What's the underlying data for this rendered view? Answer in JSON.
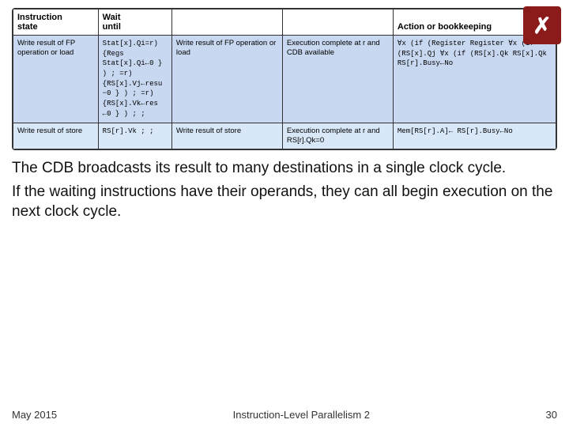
{
  "logo": {
    "symbol": "✗"
  },
  "table": {
    "headers": [
      {
        "id": "instruction",
        "line1": "Instruction",
        "line2": "state"
      },
      {
        "id": "wait",
        "line1": "Wait",
        "line2": "until"
      },
      {
        "id": "write",
        "line1": "",
        "line2": ""
      },
      {
        "id": "execution",
        "line1": "",
        "line2": ""
      },
      {
        "id": "action",
        "line1": "Action or bookkeeping",
        "line2": ""
      }
    ],
    "rows": [
      {
        "instruction": "Write result of FP operation or load",
        "wait": "Stat[x].Qi=r) {Regs Stat[x].Qi←0 } ) ; =r) {RS[x].Vj←resu −0 } ) ; =r) {RS[x].Vk←res ←0 } ) ; ;",
        "write": "Write result of FP operation or load",
        "execution": "Execution complete at r and CDB available",
        "action": "∀x (if (Register Register ∀x (if (RS[x].Qj ∀x (if (RS[x].Qk RS[x].Qk RS[r].Busy←No"
      },
      {
        "instruction": "Write result of store",
        "wait": "RS[r].Vk ; ;",
        "write": "Write result of store",
        "execution": "Execution complete at r and RS[r].Qk=0",
        "action": "Mem[RS[r].A]← RS[r].Busy←No"
      }
    ]
  },
  "text_blocks": [
    "The CDB broadcasts its result to many destinations in a single clock cycle.",
    "If the waiting instructions have their operands, they can all begin execution on the next clock cycle."
  ],
  "footer": {
    "date": "May 2015",
    "title": "Instruction-Level Parallelism 2",
    "page": "30"
  }
}
